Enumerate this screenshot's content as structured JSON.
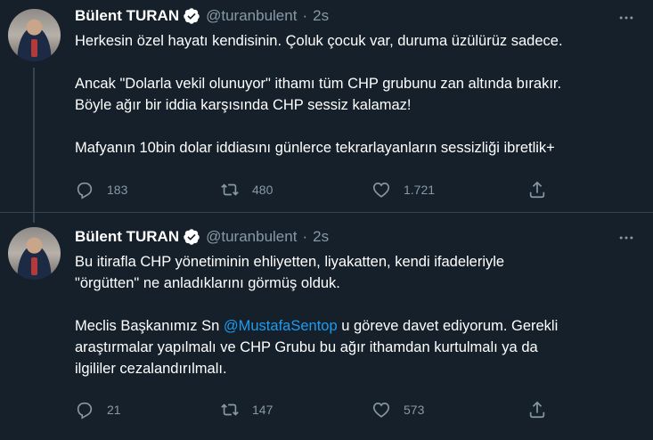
{
  "tweets": [
    {
      "name": "Bülent TURAN",
      "handle": "@turanbulent",
      "separator": "·",
      "time": "2s",
      "lines": [
        "Herkesin özel hayatı kendisinin. Çoluk çocuk var, duruma üzülürüz sadece.",
        "",
        "Ancak \"Dolarla vekil olunuyor\" ithamı tüm CHP grubunu zan altında bırakır.",
        "Böyle ağır bir iddia karşısında CHP sessiz kalamaz!",
        "",
        "Mafyanın 10bin dolar iddiasını günlerce tekrarlayanların sessizliği ibretlik+"
      ],
      "replies": "183",
      "retweets": "480",
      "likes": "1.721"
    },
    {
      "name": "Bülent TURAN",
      "handle": "@turanbulent",
      "separator": "·",
      "time": "2s",
      "line1": "Bu itirafla CHP yönetiminin ehliyetten, liyakatten, kendi ifadeleriyle",
      "line2": "\"örgütten\" ne anladıklarını görmüş olduk.",
      "line3_pre": "Meclis Başkanımız Sn ",
      "line3_mention": "@MustafaSentop",
      "line3_post": " u göreve davet ediyorum. Gerekli",
      "line4": "araştırmalar yapılmalı ve CHP Grubu bu ağır ithamdan kurtulmalı ya da",
      "line5": "ilgililer cezalandırılmalı.",
      "replies": "21",
      "retweets": "147",
      "likes": "573"
    }
  ],
  "colors": {
    "background": "#15202b",
    "text": "#ffffff",
    "secondary": "#8899a6",
    "accent": "#1d9bf0",
    "divider": "#38444d"
  },
  "icons": [
    "verified-badge-icon",
    "more-icon",
    "reply-icon",
    "retweet-icon",
    "like-icon",
    "share-icon"
  ]
}
